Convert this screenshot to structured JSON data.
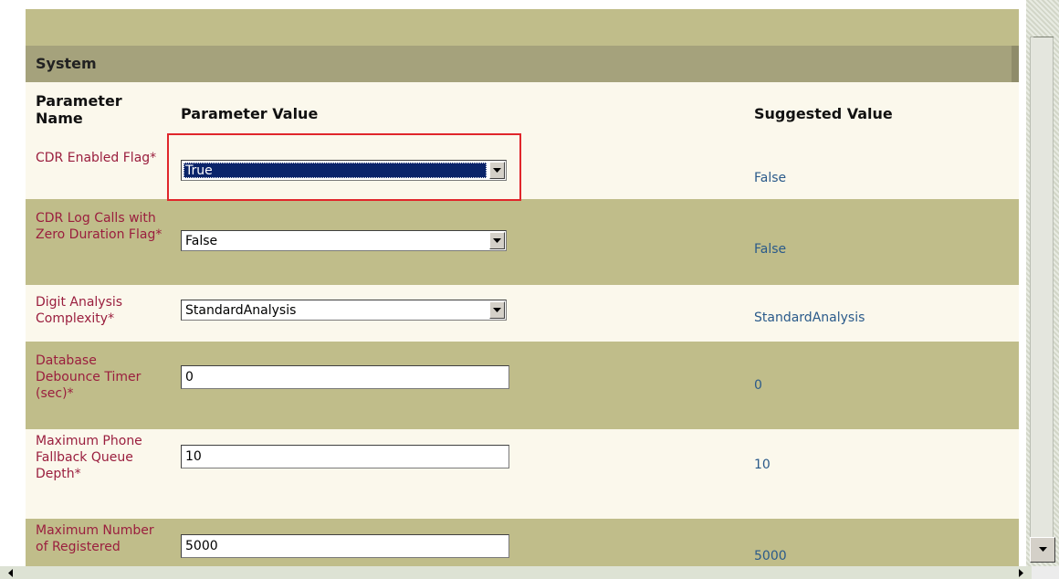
{
  "section": {
    "title": "System"
  },
  "columns": {
    "name": "Parameter Name",
    "value": "Parameter Value",
    "suggested": "Suggested Value"
  },
  "params": [
    {
      "name": "CDR Enabled Flag*",
      "control": "select",
      "value": "True",
      "suggested": "False",
      "selected": true
    },
    {
      "name": "CDR Log Calls with Zero Duration Flag*",
      "control": "select",
      "value": "False",
      "suggested": "False"
    },
    {
      "name": "Digit Analysis Complexity*",
      "control": "select",
      "value": "StandardAnalysis",
      "suggested": "StandardAnalysis"
    },
    {
      "name": "Database Debounce Timer (sec)*",
      "control": "text",
      "value": "0",
      "suggested": "0"
    },
    {
      "name": "Maximum Phone Fallback Queue Depth*",
      "control": "text",
      "value": "10",
      "suggested": "10"
    },
    {
      "name": "Maximum Number of Registered",
      "control": "text",
      "value": "5000",
      "suggested": "5000"
    }
  ],
  "colors": {
    "band": "#c0bd8a",
    "header": "#a5a27c",
    "param_name": "#9a1e3e",
    "suggested": "#2a5a8a",
    "highlight": "#e0262b",
    "selection": "#0a246a"
  },
  "icons": [
    "dropdown-arrow-icon",
    "scroll-left-arrow-icon",
    "scroll-right-arrow-icon",
    "scroll-down-arrow-icon"
  ]
}
